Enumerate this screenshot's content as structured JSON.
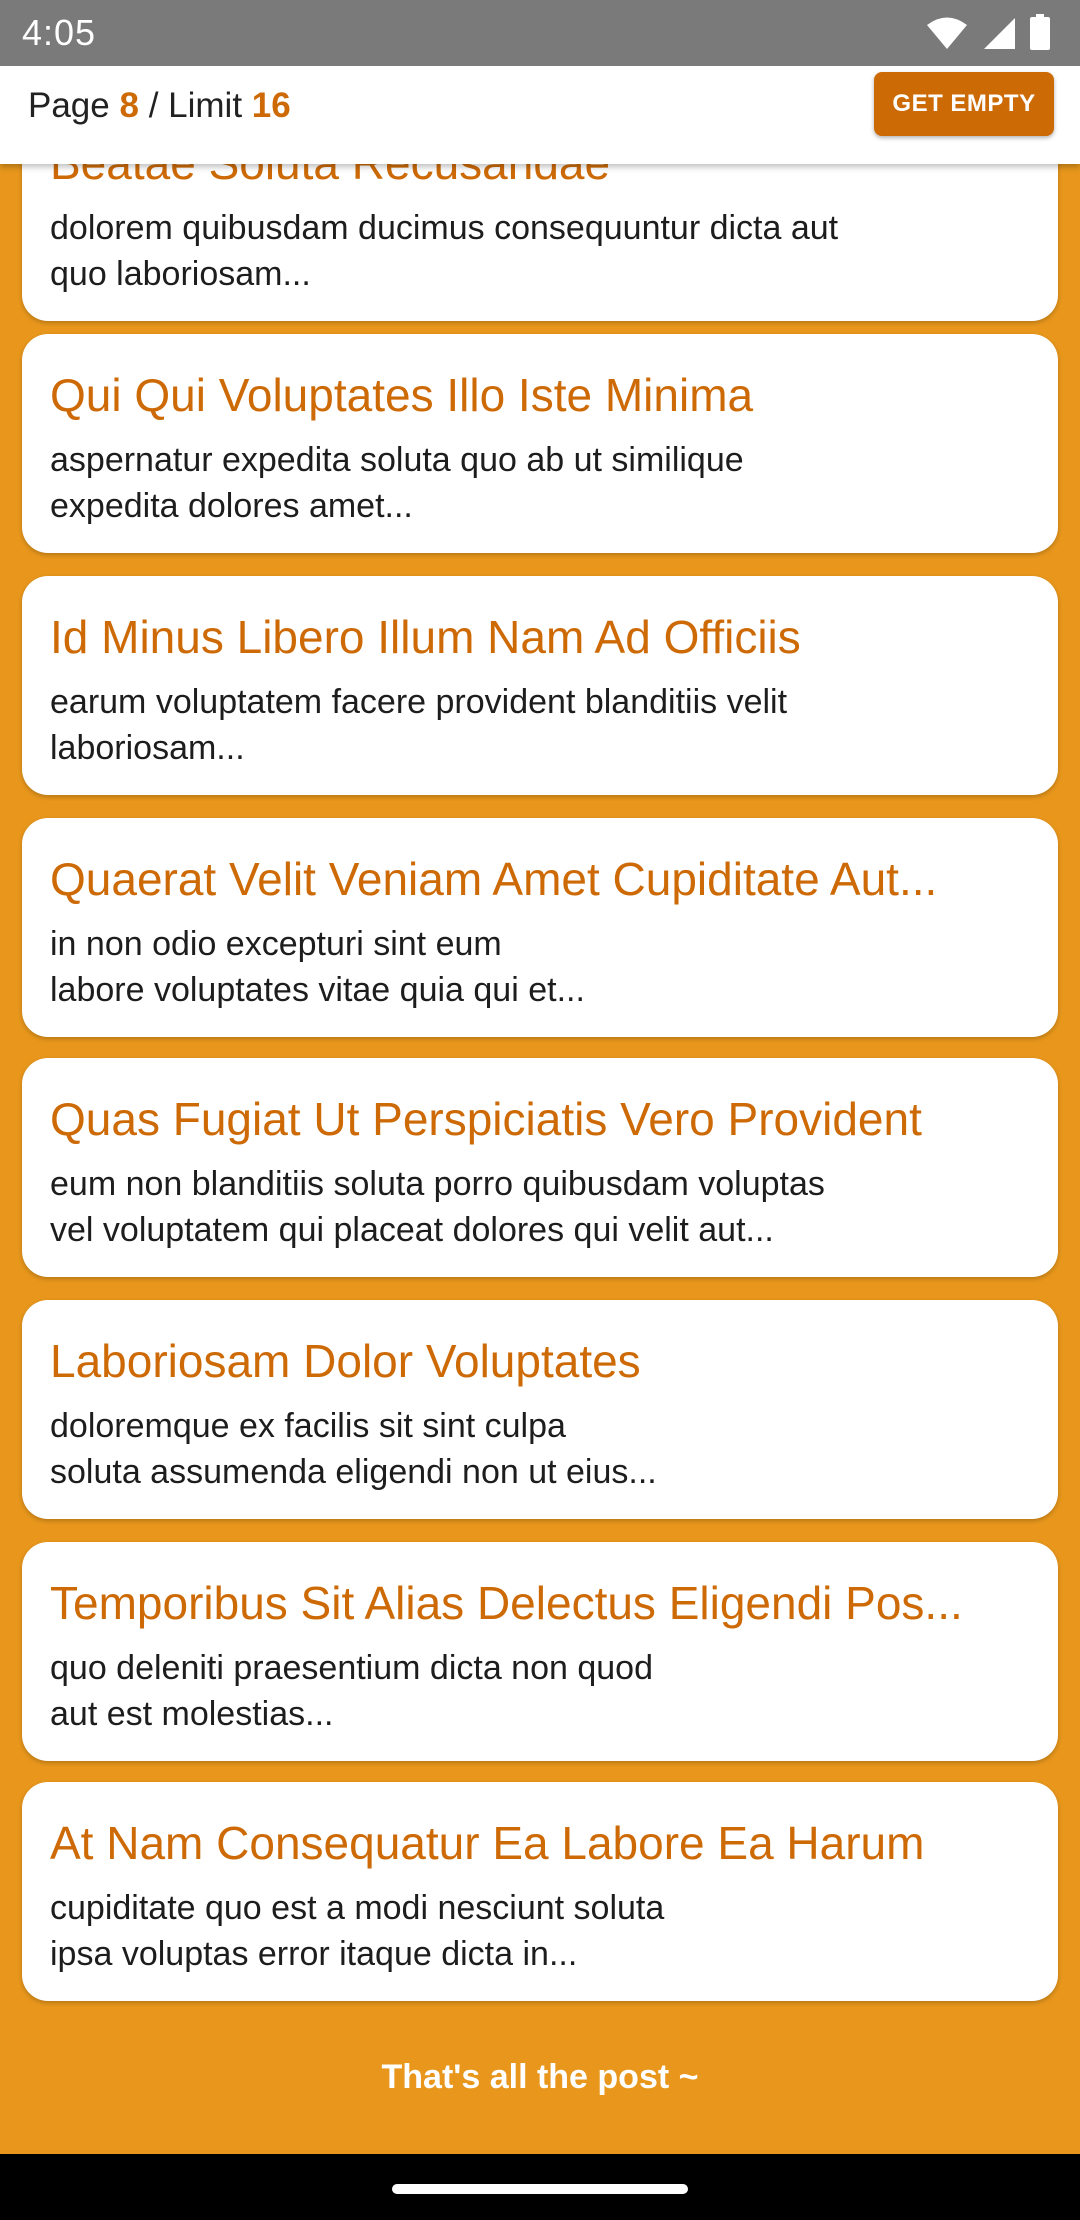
{
  "status": {
    "time": "4:05"
  },
  "header": {
    "page_label": "Page",
    "page_number": "8",
    "separator": "/",
    "limit_label": "Limit",
    "limit_number": "16",
    "button_label": "GET EMPTY"
  },
  "posts": [
    {
      "title": "Beatae Soluta Recusandae",
      "body": "dolorem quibusdam ducimus consequuntur dicta aut\nquo laboriosam..."
    },
    {
      "title": "Qui Qui Voluptates Illo Iste Minima",
      "body": "aspernatur expedita soluta quo ab ut similique\nexpedita dolores amet..."
    },
    {
      "title": "Id Minus Libero Illum Nam Ad Officiis",
      "body": "earum voluptatem facere provident blanditiis velit\nlaboriosam..."
    },
    {
      "title": "Quaerat Velit Veniam Amet Cupiditate Aut...",
      "body": "in non odio excepturi sint eum\nlabore voluptates vitae quia qui et..."
    },
    {
      "title": "Quas Fugiat Ut Perspiciatis Vero Provident",
      "body": "eum non blanditiis soluta porro quibusdam voluptas\nvel voluptatem qui placeat dolores qui velit aut..."
    },
    {
      "title": "Laboriosam Dolor Voluptates",
      "body": "doloremque ex facilis sit sint culpa\nsoluta assumenda eligendi non ut eius..."
    },
    {
      "title": "Temporibus Sit Alias Delectus Eligendi Pos...",
      "body": "quo deleniti praesentium dicta non quod\naut est molestias..."
    },
    {
      "title": "At Nam Consequatur Ea Labore Ea Harum",
      "body": "cupiditate quo est a modi nesciunt soluta\nipsa voluptas error itaque dicta in..."
    }
  ],
  "footer": {
    "text": "That's all the post ~"
  },
  "colors": {
    "background": "#e8971c",
    "accent": "#cd6a06"
  }
}
